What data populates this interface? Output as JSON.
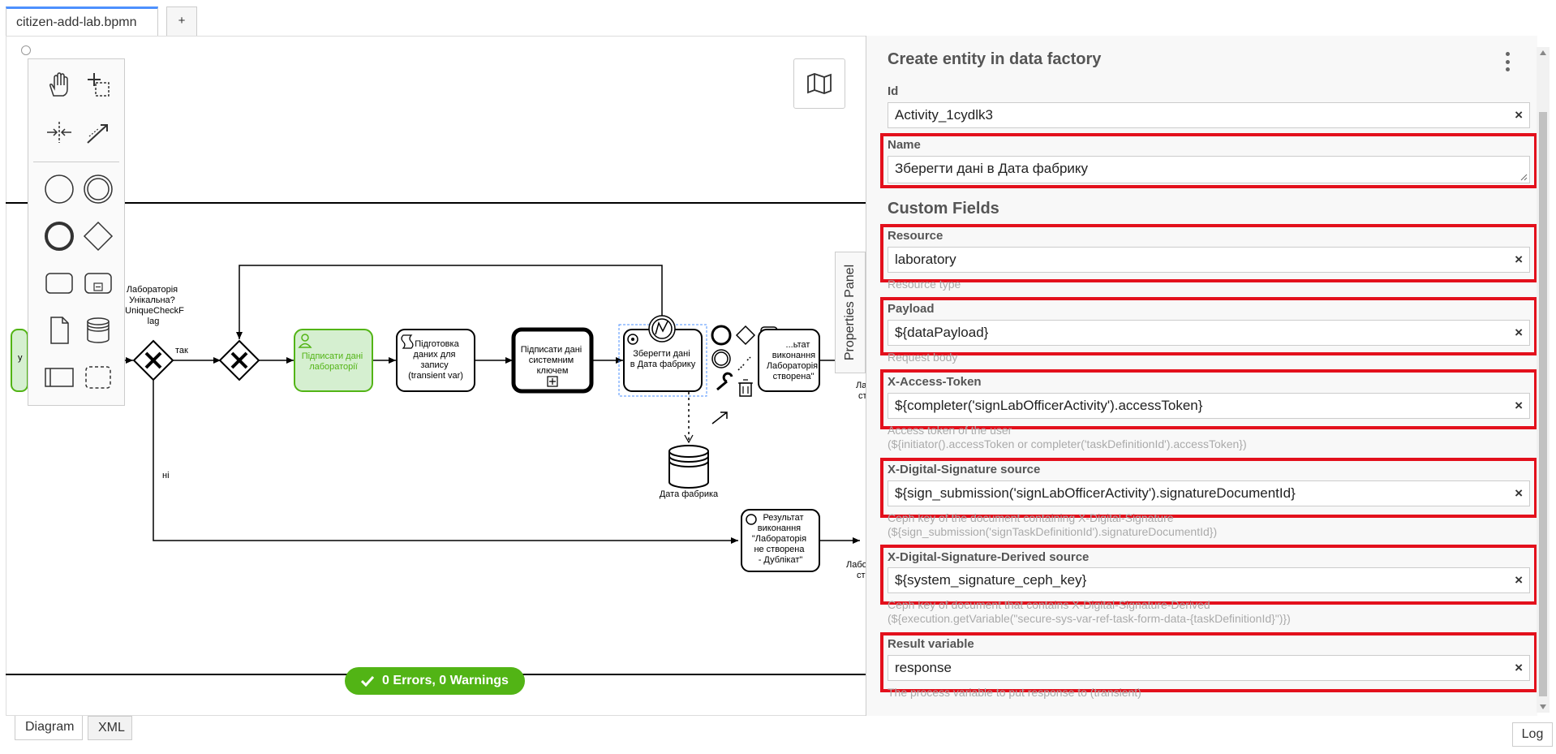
{
  "tabs": {
    "file_name": "citizen-add-lab.bpmn",
    "add_label": "+"
  },
  "diagram": {
    "gateway_question": [
      "Лабораторія",
      "Унікальна?",
      "bUniqueCheckF",
      "lag"
    ],
    "flow_yes": "так",
    "flow_no": "ні",
    "task_sign_lab": [
      "Підписати дані",
      "лабораторії"
    ],
    "task_prepare": [
      "Підготовка",
      "даних для",
      "запису",
      "(transient var)"
    ],
    "task_sign_system": [
      "Підписати дані",
      "системним",
      "ключем"
    ],
    "task_save": [
      "Зберегти дані",
      "в Дата фабрику"
    ],
    "task_result_created": [
      "...ьтат",
      "виконання",
      "Лабораторія",
      "створена\""
    ],
    "task_result_duplicate": [
      "Результат",
      "виконання",
      "\"Лабораторія",
      "не створена",
      "- Дублікат\""
    ],
    "data_store": "Дата фабрика",
    "left_task_partial": "у",
    "end_label_partial_1": "Лаб",
    "end_label_partial_2": "ст",
    "end_label_partial_3": "Лабо",
    "end_label_partial_4": "ст"
  },
  "status": {
    "text": "0 Errors, 0 Warnings",
    "color": "#52b415"
  },
  "bottom_tabs": {
    "diagram": "Diagram",
    "xml": "XML",
    "log": "Log"
  },
  "properties_toggle": "Properties Panel",
  "panel": {
    "title": "Create entity in data factory",
    "custom_fields_title": "Custom Fields",
    "fields": {
      "id": {
        "label": "Id",
        "value": "Activity_1cydlk3"
      },
      "name": {
        "label": "Name",
        "value": "Зберегти дані в Дата фабрику"
      },
      "resource": {
        "label": "Resource",
        "value": "laboratory",
        "desc": "Resource type"
      },
      "payload": {
        "label": "Payload",
        "value": "${dataPayload}",
        "desc": "Request body"
      },
      "access_token": {
        "label": "X-Access-Token",
        "value": "${completer('signLabOfficerActivity').accessToken}",
        "desc1": "Access token of the user",
        "desc2": "(${initiator().accessToken or completer('taskDefinitionId').accessToken})"
      },
      "signature_source": {
        "label": "X-Digital-Signature source",
        "value": "${sign_submission('signLabOfficerActivity').signatureDocumentId}",
        "desc1": "Ceph key of the document containing X-Digital-Signature",
        "desc2": "(${sign_submission('signTaskDefinitionId').signatureDocumentId})"
      },
      "derived_source": {
        "label": "X-Digital-Signature-Derived source",
        "value": "${system_signature_ceph_key}",
        "desc1": "Ceph key of document that contains X-Digital-Signature-Derived",
        "desc2": "(${execution.getVariable(\"secure-sys-var-ref-task-form-data-{taskDefinitionId}\")})"
      },
      "result_variable": {
        "label": "Result variable",
        "value": "response",
        "desc": "The process variable to put response to (transient)"
      }
    },
    "clear_glyph": "×"
  },
  "colors": {
    "highlight": "#e3101c",
    "user_task_fill": "#d5efd0",
    "user_task_stroke": "#52b415"
  },
  "icons": [
    "hand-tool-icon",
    "lasso-tool-icon",
    "space-tool-icon",
    "connect-tool-icon",
    "start-event-icon",
    "intermediate-event-icon",
    "end-event-icon",
    "gateway-icon",
    "task-icon",
    "subprocess-icon",
    "data-object-icon",
    "data-store-icon",
    "pool-icon",
    "group-icon",
    "minimap-icon",
    "checkmark-icon",
    "menu-dots-icon"
  ]
}
